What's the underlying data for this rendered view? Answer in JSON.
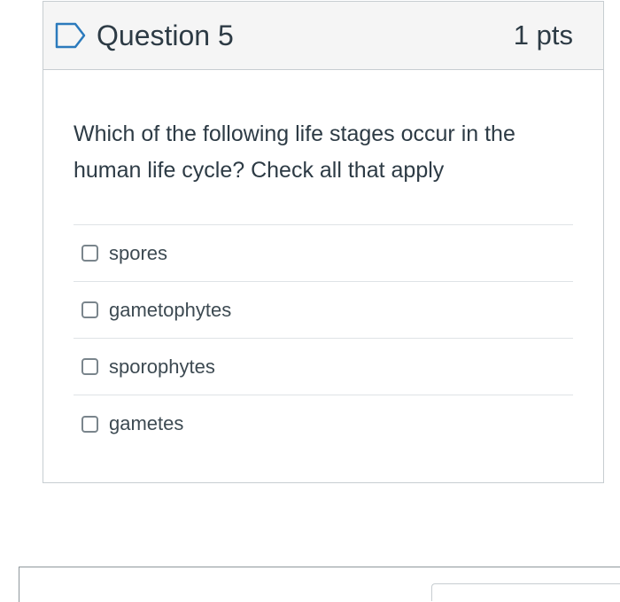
{
  "question": {
    "title": "Question 5",
    "points": "1 pts",
    "text": "Which of the following life stages occur in the human life cycle? Check all that apply",
    "flag_icon": "flag-outline-icon",
    "answers": [
      {
        "label": "spores",
        "checked": false
      },
      {
        "label": "gametophytes",
        "checked": false
      },
      {
        "label": "sporophytes",
        "checked": false
      },
      {
        "label": "gametes",
        "checked": false
      }
    ]
  },
  "colors": {
    "header_bg": "#f5f5f5",
    "border": "#c7cdd1",
    "text": "#2d3b45",
    "flag": "#2b7abc"
  }
}
